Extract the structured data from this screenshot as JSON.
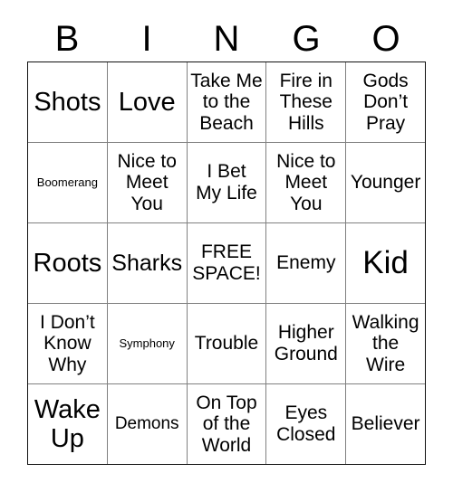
{
  "header": {
    "letters": [
      "B",
      "I",
      "N",
      "G",
      "O"
    ]
  },
  "colors": {
    "grid_line": "#808080",
    "outer_border": "#111111",
    "cell_background": "#ffffff",
    "text": "#000000"
  },
  "grid": {
    "rows": 5,
    "columns": 5,
    "cells": [
      {
        "text": "Shots",
        "size": "xl"
      },
      {
        "text": "Love",
        "size": "xl"
      },
      {
        "text": "Take Me\nto the\nBeach",
        "size": "md"
      },
      {
        "text": "Fire in\nThese\nHills",
        "size": "md"
      },
      {
        "text": "Gods\nDon’t\nPray",
        "size": "md"
      },
      {
        "text": "Boomerang",
        "size": "xs"
      },
      {
        "text": "Nice to\nMeet\nYou",
        "size": "md"
      },
      {
        "text": "I Bet\nMy Life",
        "size": "md"
      },
      {
        "text": "Nice to\nMeet\nYou",
        "size": "md"
      },
      {
        "text": "Younger",
        "size": "md"
      },
      {
        "text": "Roots",
        "size": "xl"
      },
      {
        "text": "Sharks",
        "size": "lg"
      },
      {
        "text": "FREE\nSPACE!",
        "size": "md"
      },
      {
        "text": "Enemy",
        "size": "md"
      },
      {
        "text": "Kid",
        "size": "xxl"
      },
      {
        "text": "I Don’t\nKnow\nWhy",
        "size": "md"
      },
      {
        "text": "Symphony",
        "size": "xs"
      },
      {
        "text": "Trouble",
        "size": "md"
      },
      {
        "text": "Higher\nGround",
        "size": "md"
      },
      {
        "text": "Walking\nthe\nWire",
        "size": "md"
      },
      {
        "text": "Wake\nUp",
        "size": "xl"
      },
      {
        "text": "Demons",
        "size": "sm"
      },
      {
        "text": "On Top\nof the\nWorld",
        "size": "md"
      },
      {
        "text": "Eyes\nClosed",
        "size": "md"
      },
      {
        "text": "Believer",
        "size": "md"
      }
    ]
  }
}
